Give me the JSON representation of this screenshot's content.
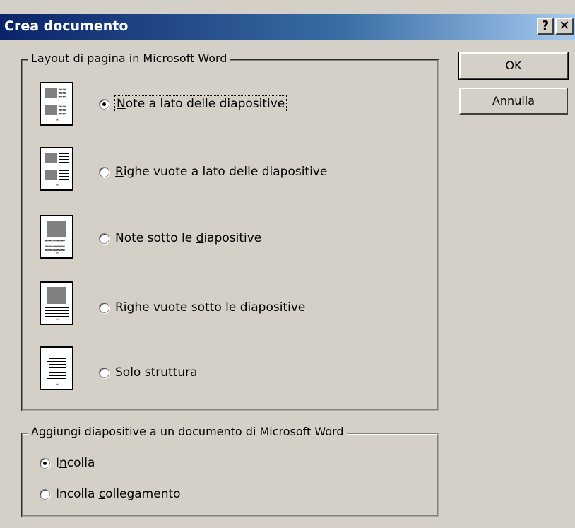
{
  "window": {
    "title": "Crea documento",
    "help_label": "?",
    "close_label": "✕"
  },
  "buttons": {
    "ok": "OK",
    "cancel": "Annulla"
  },
  "layout_group": {
    "title": "Layout di pagina in Microsoft Word",
    "selected": "note_beside",
    "options": [
      {
        "id": "note_beside",
        "before": "",
        "mnemonic": "N",
        "after": "ote a lato delle diapositive",
        "checked": true,
        "icon": "notes-beside-slides-icon"
      },
      {
        "id": "blank_beside",
        "before": "",
        "mnemonic": "R",
        "after": "ighe vuote a lato delle diapositive",
        "checked": false,
        "icon": "blank-lines-beside-slides-icon"
      },
      {
        "id": "note_below",
        "before": "Note sotto le ",
        "mnemonic": "d",
        "after": "iapositive",
        "checked": false,
        "icon": "notes-below-slides-icon"
      },
      {
        "id": "blank_below",
        "before": "Righ",
        "mnemonic": "e",
        "after": " vuote sotto le diapositive",
        "checked": false,
        "icon": "blank-lines-below-slides-icon"
      },
      {
        "id": "outline_only",
        "before": "",
        "mnemonic": "S",
        "after": "olo struttura",
        "checked": false,
        "icon": "outline-only-icon"
      }
    ]
  },
  "add_group": {
    "title": "Aggiungi diapositive a un documento di Microsoft Word",
    "options": [
      {
        "id": "paste",
        "before": "I",
        "mnemonic": "n",
        "after": "colla",
        "checked": true
      },
      {
        "id": "paste_link",
        "before": "Incolla ",
        "mnemonic": "c",
        "after": "ollegamento",
        "checked": false
      }
    ]
  }
}
